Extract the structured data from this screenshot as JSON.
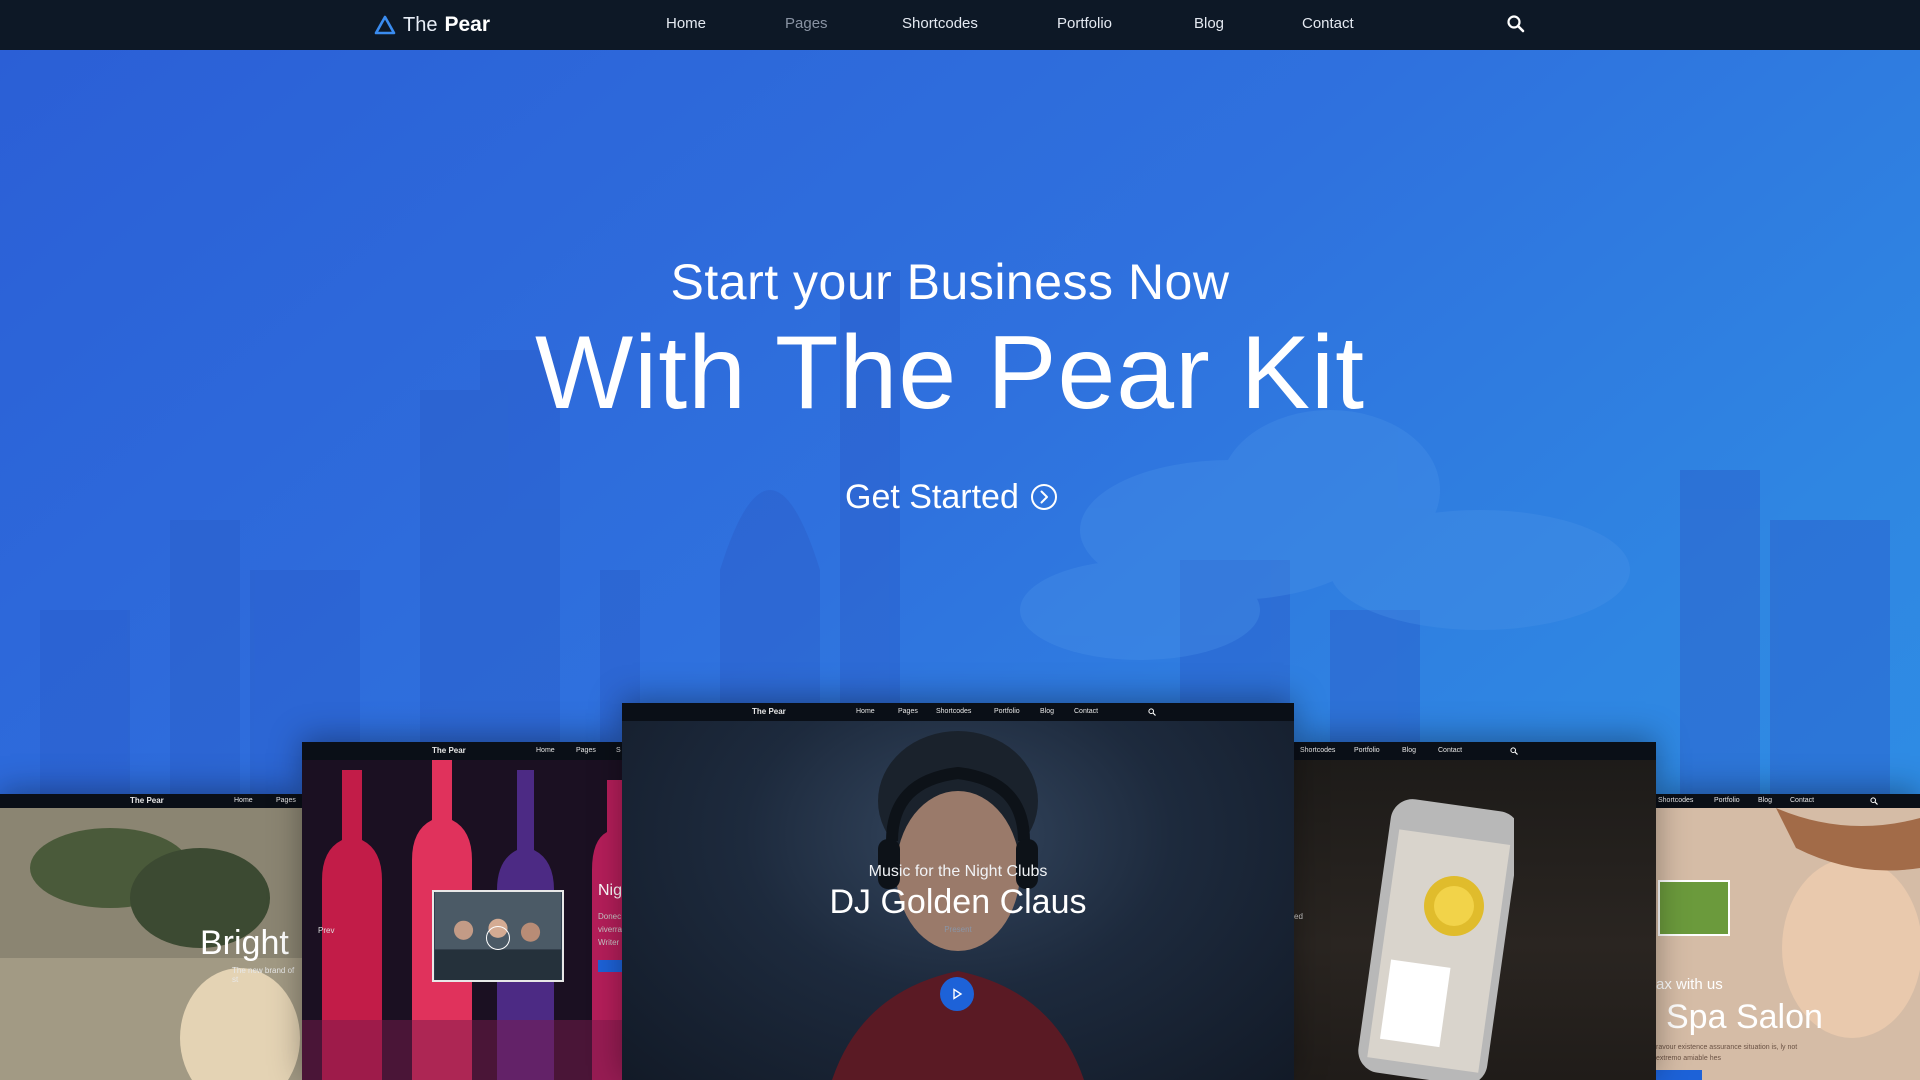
{
  "brand": {
    "prefix": "The",
    "name": "Pear"
  },
  "nav": [
    {
      "label": "Home",
      "active": false
    },
    {
      "label": "Pages",
      "active": true
    },
    {
      "label": "Shortcodes",
      "active": false
    },
    {
      "label": "Portfolio",
      "active": false
    },
    {
      "label": "Blog",
      "active": false
    },
    {
      "label": "Contact",
      "active": false
    }
  ],
  "hero": {
    "subtitle": "Start your Business Now",
    "title": "With The Pear Kit",
    "cta_label": "Get Started"
  },
  "thumbnails": {
    "bright": {
      "brand": "The Pear",
      "nav": [
        "Home",
        "Pages"
      ],
      "title": "Bright",
      "subtitle": "The new brand of st"
    },
    "nightclub": {
      "brand": "The Pear",
      "nav": [
        "Home",
        "Pages",
        "S"
      ],
      "title": "Nig",
      "text": "Donec viverra Writer",
      "prev": "Prev"
    },
    "dj": {
      "brand": "The Pear",
      "nav": [
        "Home",
        "Pages",
        "Shortcodes",
        "Portfolio",
        "Blog",
        "Contact"
      ],
      "subtitle": "Music for the Night Clubs",
      "title": "DJ Golden Claus",
      "present": "Present"
    },
    "phone": {
      "nav": [
        "Shortcodes",
        "Portfolio",
        "Blog",
        "Contact"
      ],
      "edge_text": "ed"
    },
    "spa": {
      "nav": [
        "Shortcodes",
        "Portfolio",
        "Blog",
        "Contact"
      ],
      "kicker": "ax with us",
      "title": "Spa Salon",
      "text": "ravour existence assurance situation is, ly not extremo amiable hes"
    }
  },
  "colors": {
    "nav_bg": "#0d1826",
    "hero_start": "#2b5fd6",
    "hero_end": "#2e90e6",
    "accent": "#1d62d8"
  },
  "icons": {
    "logo": "triangle-logo-icon",
    "search": "search-icon",
    "cta": "arrow-circle-right-icon",
    "play": "play-icon"
  }
}
